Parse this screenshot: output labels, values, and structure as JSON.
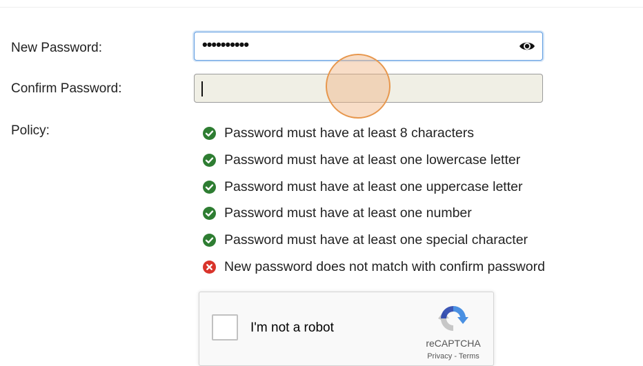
{
  "form": {
    "new_password_label": "New Password:",
    "new_password_value": "••••••••••",
    "confirm_password_label": "Confirm Password:",
    "confirm_password_value": "",
    "policy_label": "Policy:"
  },
  "policy": {
    "items": [
      {
        "text": "Password must have at least 8 characters",
        "status": "pass"
      },
      {
        "text": "Password must have at least one lowercase letter",
        "status": "pass"
      },
      {
        "text": "Password must have at least one uppercase letter",
        "status": "pass"
      },
      {
        "text": "Password must have at least one number",
        "status": "pass"
      },
      {
        "text": "Password must have at least one special character",
        "status": "pass"
      },
      {
        "text": "New password does not match with confirm password",
        "status": "fail"
      }
    ]
  },
  "recaptcha": {
    "checkbox_label": "I'm not a robot",
    "brand": "reCAPTCHA",
    "privacy_link": "Privacy",
    "separator": " - ",
    "terms_link": "Terms"
  },
  "icons": {
    "reveal_password": "eye-icon",
    "pass": "check-circle-icon",
    "fail": "x-circle-icon",
    "recaptcha_logo": "recaptcha-logo"
  },
  "colors": {
    "pass": "#2e7d32",
    "fail": "#d9342b",
    "focus_border": "#5b9ae0",
    "confirm_field_bg": "#f0efe5",
    "touch_indicator": "#e7974d"
  }
}
